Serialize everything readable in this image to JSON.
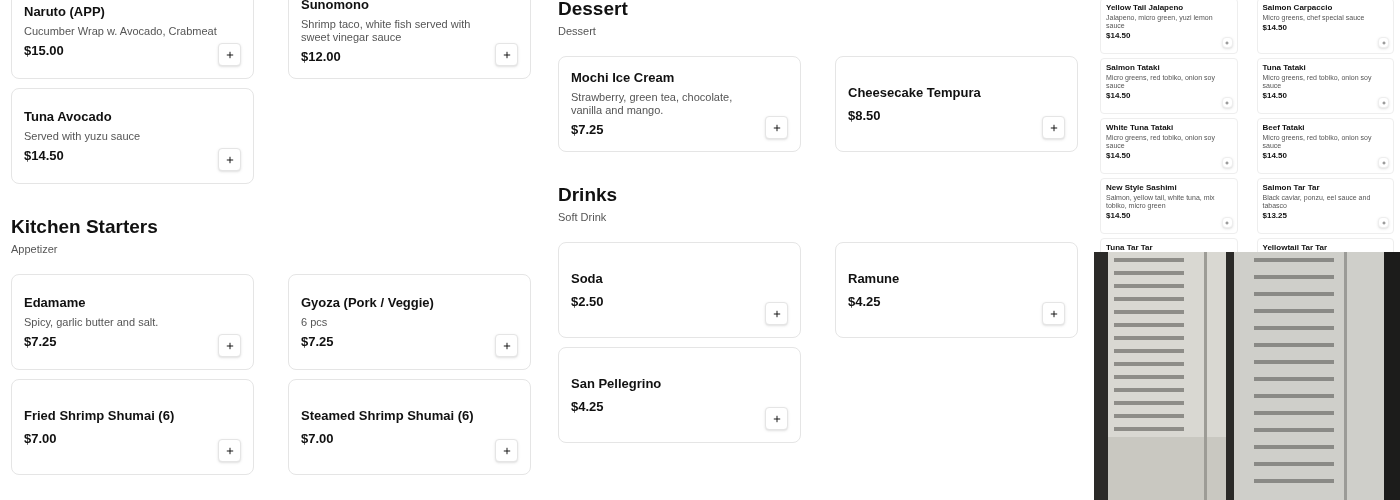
{
  "left": [
    {
      "items": [
        {
          "name": "Naruto (APP)",
          "description": "Cucumber Wrap w. Avocado, Crabmeat",
          "price": "$15.00"
        },
        {
          "name": "Sunomono",
          "description": "Shrimp taco, white fish served with sweet vinegar sauce",
          "price": "$12.00"
        },
        {
          "name": "Tuna Avocado",
          "description": "Served with yuzu sauce",
          "price": "$14.50"
        }
      ]
    },
    {
      "title": "Kitchen Starters",
      "subtitle": "Appetizer",
      "items": [
        {
          "name": "Edamame",
          "description": "Spicy, garlic butter and salt.",
          "price": "$7.25"
        },
        {
          "name": "Gyoza (Pork / Veggie)",
          "description": "6 pcs",
          "price": "$7.25"
        },
        {
          "name": "Fried Shrimp Shumai (6)",
          "price": "$7.00"
        },
        {
          "name": "Steamed Shrimp Shumai (6)",
          "price": "$7.00"
        }
      ]
    }
  ],
  "middle": [
    {
      "title": "Dessert",
      "subtitle": "Dessert",
      "items": [
        {
          "name": "Mochi Ice Cream",
          "description": "Strawberry, green tea, chocolate, vanilla and mango.",
          "price": "$7.25"
        },
        {
          "name": "Cheesecake Tempura",
          "price": "$8.50"
        }
      ]
    },
    {
      "title": "Drinks",
      "subtitle": "Soft Drink",
      "items": [
        {
          "name": "Soda",
          "price": "$2.50"
        },
        {
          "name": "Ramune",
          "price": "$4.25"
        },
        {
          "name": "San Pellegrino",
          "price": "$4.25"
        }
      ]
    }
  ],
  "preview": {
    "items": [
      {
        "name": "Yellow Tail Jalapeno",
        "description": "Jalapeno, micro green, yuzi lemon sauce",
        "price": "$14.50"
      },
      {
        "name": "Salmon Carpaccio",
        "description": "Micro greens, chef special sauce",
        "price": "$14.50"
      },
      {
        "name": "Salmon Tataki",
        "description": "Micro greens, red tobiko, onion soy sauce",
        "price": "$14.50"
      },
      {
        "name": "Tuna Tataki",
        "description": "Micro greens, red tobiko, onion soy sauce",
        "price": "$14.50"
      },
      {
        "name": "White Tuna Tataki",
        "description": "Micro greens, red tobiko, onion soy sauce",
        "price": "$14.50"
      },
      {
        "name": "Beef Tataki",
        "description": "Micro greens, red tobiko, onion soy sauce",
        "price": "$14.50"
      },
      {
        "name": "New Style Sashimi",
        "description": "Salmon, yellow tail, white tuna, mix tobiko, micro green",
        "price": "$14.50"
      },
      {
        "name": "Salmon Tar Tar",
        "description": "Black caviar, ponzu, eel sauce and tabasco",
        "price": "$13.25"
      },
      {
        "name": "Tuna Tar Tar"
      },
      {
        "name": "Yellowtail Tar Tar"
      }
    ]
  }
}
